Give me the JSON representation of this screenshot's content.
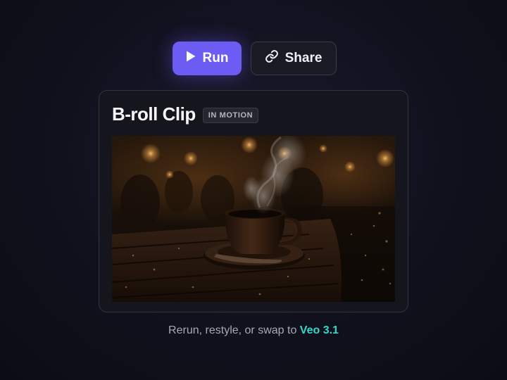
{
  "actions": {
    "run_label": "Run",
    "share_label": "Share",
    "run_icon": "play-icon",
    "share_icon": "link-icon"
  },
  "card": {
    "title": "B-roll Clip",
    "badge": "IN MOTION",
    "image_alt": "Steaming coffee cup on a wet wooden table in a dimly lit café"
  },
  "footer": {
    "text": "Rerun, restyle, or swap to",
    "model": "Veo 3.1"
  },
  "colors": {
    "accent": "#6c5cf4",
    "model_highlight": "#34d8c8",
    "background": "#121220"
  }
}
